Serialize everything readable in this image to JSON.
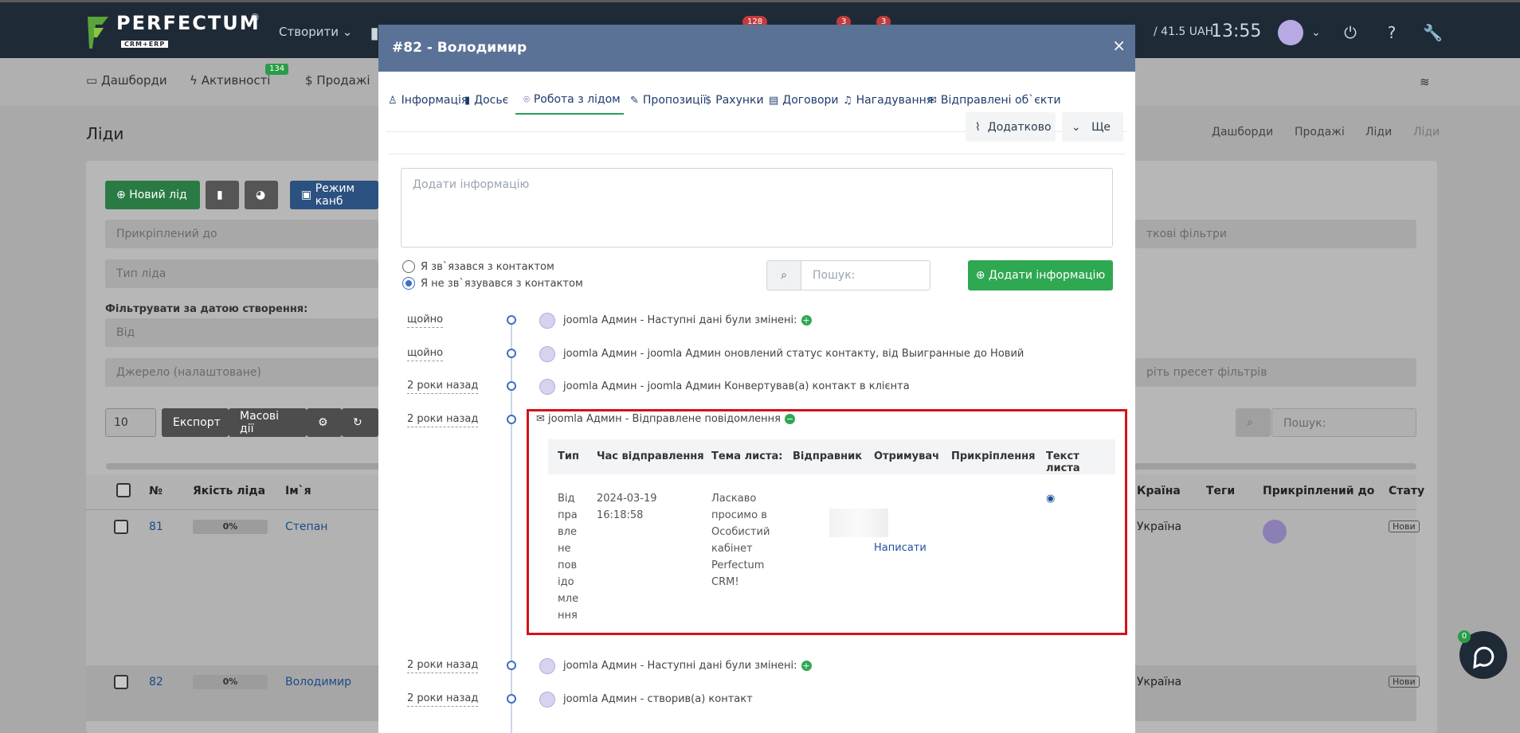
{
  "app": {
    "logo_text": "PERFECTUM",
    "logo_sub": "CRM+ERP",
    "logo_reg": "®",
    "create_label": "Створити",
    "badges": [
      "128",
      "3",
      "3"
    ],
    "balance": "/ 41.5 UAH",
    "time": "13:55"
  },
  "nav": {
    "items": [
      {
        "label": "Дашборди"
      },
      {
        "label": "Активності",
        "badge": "134"
      },
      {
        "label": "Продажі"
      }
    ]
  },
  "page": {
    "title": "Ліди",
    "breadcrumb": [
      "Дашборди",
      "Продажі",
      "Ліди",
      "Ліди"
    ],
    "buttons": {
      "new_lead": "Новий лід",
      "kanban": "Режим канб"
    },
    "filters": {
      "attached_to": "Прикріплений до",
      "lead_type": "Тип ліда",
      "date_filter_label": "Фільтрувати за датою створення:",
      "from": "Від",
      "source": "Джерело (налаштоване)",
      "extra_filters": "ткові фільтри",
      "preset": "ріть пресет фільтрів"
    },
    "table_controls": {
      "page_size": "10",
      "export": "Експорт",
      "bulk": "Масові дії",
      "search": "Пошук:"
    },
    "columns": [
      "№",
      "Якість ліда",
      "Ім`я",
      "Країна",
      "Теги",
      "Прикріплений до",
      "Стату"
    ],
    "rows": [
      {
        "id": "81",
        "quality": "0%",
        "name": "Степан",
        "country": "Україна",
        "status": "Нови"
      },
      {
        "id": "82",
        "quality": "0%",
        "name": "Володимир",
        "country": "Україна",
        "status": "Нови"
      }
    ]
  },
  "modal": {
    "title": "#82 - Володимир",
    "close": "×",
    "tabs": [
      {
        "label": "Інформація",
        "icon": "user-icon"
      },
      {
        "label": "Досьє",
        "icon": "book-icon"
      },
      {
        "label": "Робота з лідом",
        "icon": "pin-icon"
      },
      {
        "label": "Пропозиції",
        "icon": "pencil-icon"
      },
      {
        "label": "Рахунки",
        "icon": "dollar-icon"
      },
      {
        "label": "Договори",
        "icon": "file-icon"
      },
      {
        "label": "Нагадування",
        "icon": "bell-icon"
      },
      {
        "label": "Відправлені об`єкти",
        "icon": "mail-icon"
      }
    ],
    "toolbar": {
      "more_label": "Додатково",
      "also_label": "Ще"
    },
    "textarea_placeholder": "Додати інформацію",
    "contact_options": [
      {
        "label": "Я зв`язався з контактом",
        "checked": false
      },
      {
        "label": "Я не зв`язувався з контактом",
        "checked": true
      }
    ],
    "search_placeholder": "Пошук:",
    "add_button": "Додати інформацію",
    "timeline": [
      {
        "time": "щойно",
        "text": "joomla Админ - Наступні дані були змінені:",
        "toggle": "+"
      },
      {
        "time": "щойно",
        "text": "joomla Админ - joomla Админ оновлений статус контакту, від Выигранные до Новий"
      },
      {
        "time": "2 роки назад",
        "text": "joomla Админ - joomla Админ Конвертував(а) контакт в клієнта"
      },
      {
        "time": "2 роки назад",
        "text": "joomla Админ - Відправлене повідомлення",
        "toggle": "−"
      },
      {
        "time": "2 роки назад",
        "text": "joomla Админ - Наступні дані були змінені:",
        "toggle": "+"
      },
      {
        "time": "2 роки назад",
        "text": "joomla Админ - створив(а) контакт"
      }
    ],
    "mail_table": {
      "headers": [
        "Тип",
        "Час відправлення",
        "Тема листа:",
        "Відправник",
        "Отримувач",
        "Прикріплення",
        "Текст листа"
      ],
      "type_lines": [
        "Від",
        "пра",
        "вле",
        "не",
        "пов",
        "ідо",
        "мле",
        "ння"
      ],
      "sent_date": "2024-03-19",
      "sent_time": "16:18:58",
      "subject_lines": [
        "Ласкаво",
        "просимо в",
        "Особистий",
        "кабінет",
        "Perfectum",
        "CRM!"
      ],
      "recipient_action": "Написати"
    }
  },
  "chat": {
    "badge": "0"
  }
}
